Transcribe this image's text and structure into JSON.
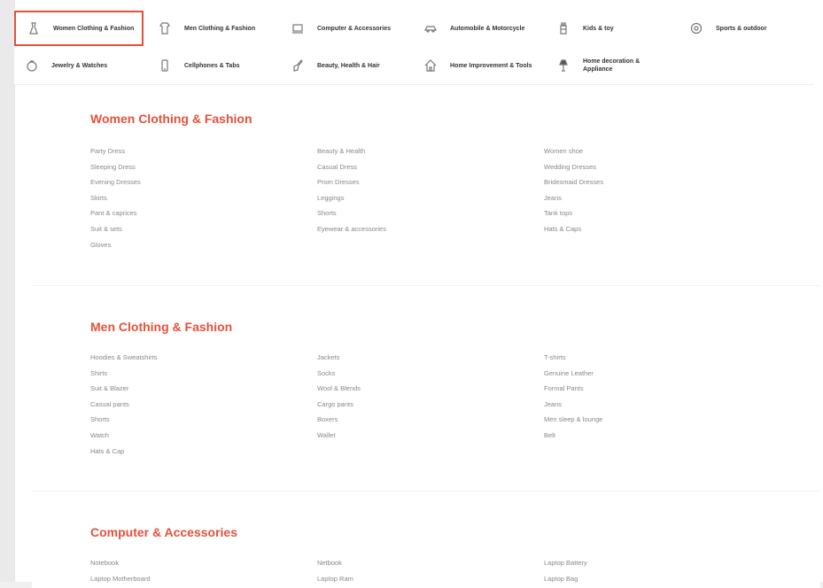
{
  "nav": {
    "row1": [
      {
        "label": "Women Clothing & Fashion",
        "icon": "dress-icon",
        "active": true
      },
      {
        "label": "Men Clothing & Fashion",
        "icon": "shirt-icon"
      },
      {
        "label": "Computer & Accessories",
        "icon": "laptop-icon"
      },
      {
        "label": "Automobile & Motorcycle",
        "icon": "car-icon"
      },
      {
        "label": "Kids & toy",
        "icon": "bottle-icon"
      },
      {
        "label": "Sports & outdoor",
        "icon": "ball-icon"
      }
    ],
    "row2": [
      {
        "label": "Jewelry & Watches",
        "icon": "ring-icon"
      },
      {
        "label": "Cellphones & Tabs",
        "icon": "phone-icon"
      },
      {
        "label": "Beauty, Health & Hair",
        "icon": "brush-icon"
      },
      {
        "label": "Home Improvement & Tools",
        "icon": "house-icon"
      },
      {
        "label": "Home decoration & Appliance",
        "icon": "lamp-icon"
      }
    ]
  },
  "sections": [
    {
      "title": "Women Clothing & Fashion",
      "columns": [
        [
          "Party Dress",
          "Sleeping Dress",
          "Evening Dresses",
          "Skirts",
          "Pant & caprices",
          "Suit & sets",
          "Gloves"
        ],
        [
          "Beauty & Health",
          "Casual Dress",
          "Prom Dresses",
          "Leggings",
          "Shorts",
          "Eyewear & accessories"
        ],
        [
          "Women shoe",
          "Wedding Dresses",
          "Bridesmaid Dresses",
          "Jeans",
          "Tank tops",
          "Hats & Caps"
        ]
      ]
    },
    {
      "title": "Men Clothing & Fashion",
      "columns": [
        [
          "Hoodies & Sweatshirts",
          "Shirts",
          "Suit & Blazer",
          "Casual pants",
          "Shorts",
          "Watch",
          "Hats & Cap"
        ],
        [
          "Jackets",
          "Socks",
          "Wool & Blends",
          "Cargo pants",
          "Boxers",
          "Wallet"
        ],
        [
          "T-shirts",
          "Genuine Leather",
          "Formal Pants",
          "Jeans",
          "Men sleep & lounge",
          "Belt"
        ]
      ]
    },
    {
      "title": "Computer & Accessories",
      "columns": [
        [
          "Notebook",
          "Laptop Motherboard"
        ],
        [
          "Netbook",
          "Laptop Ram"
        ],
        [
          "Laptop Battery",
          "Laptop Bag"
        ]
      ]
    }
  ],
  "colors": {
    "accent": "#e4513a",
    "text": "#333333",
    "muted": "#888888"
  }
}
